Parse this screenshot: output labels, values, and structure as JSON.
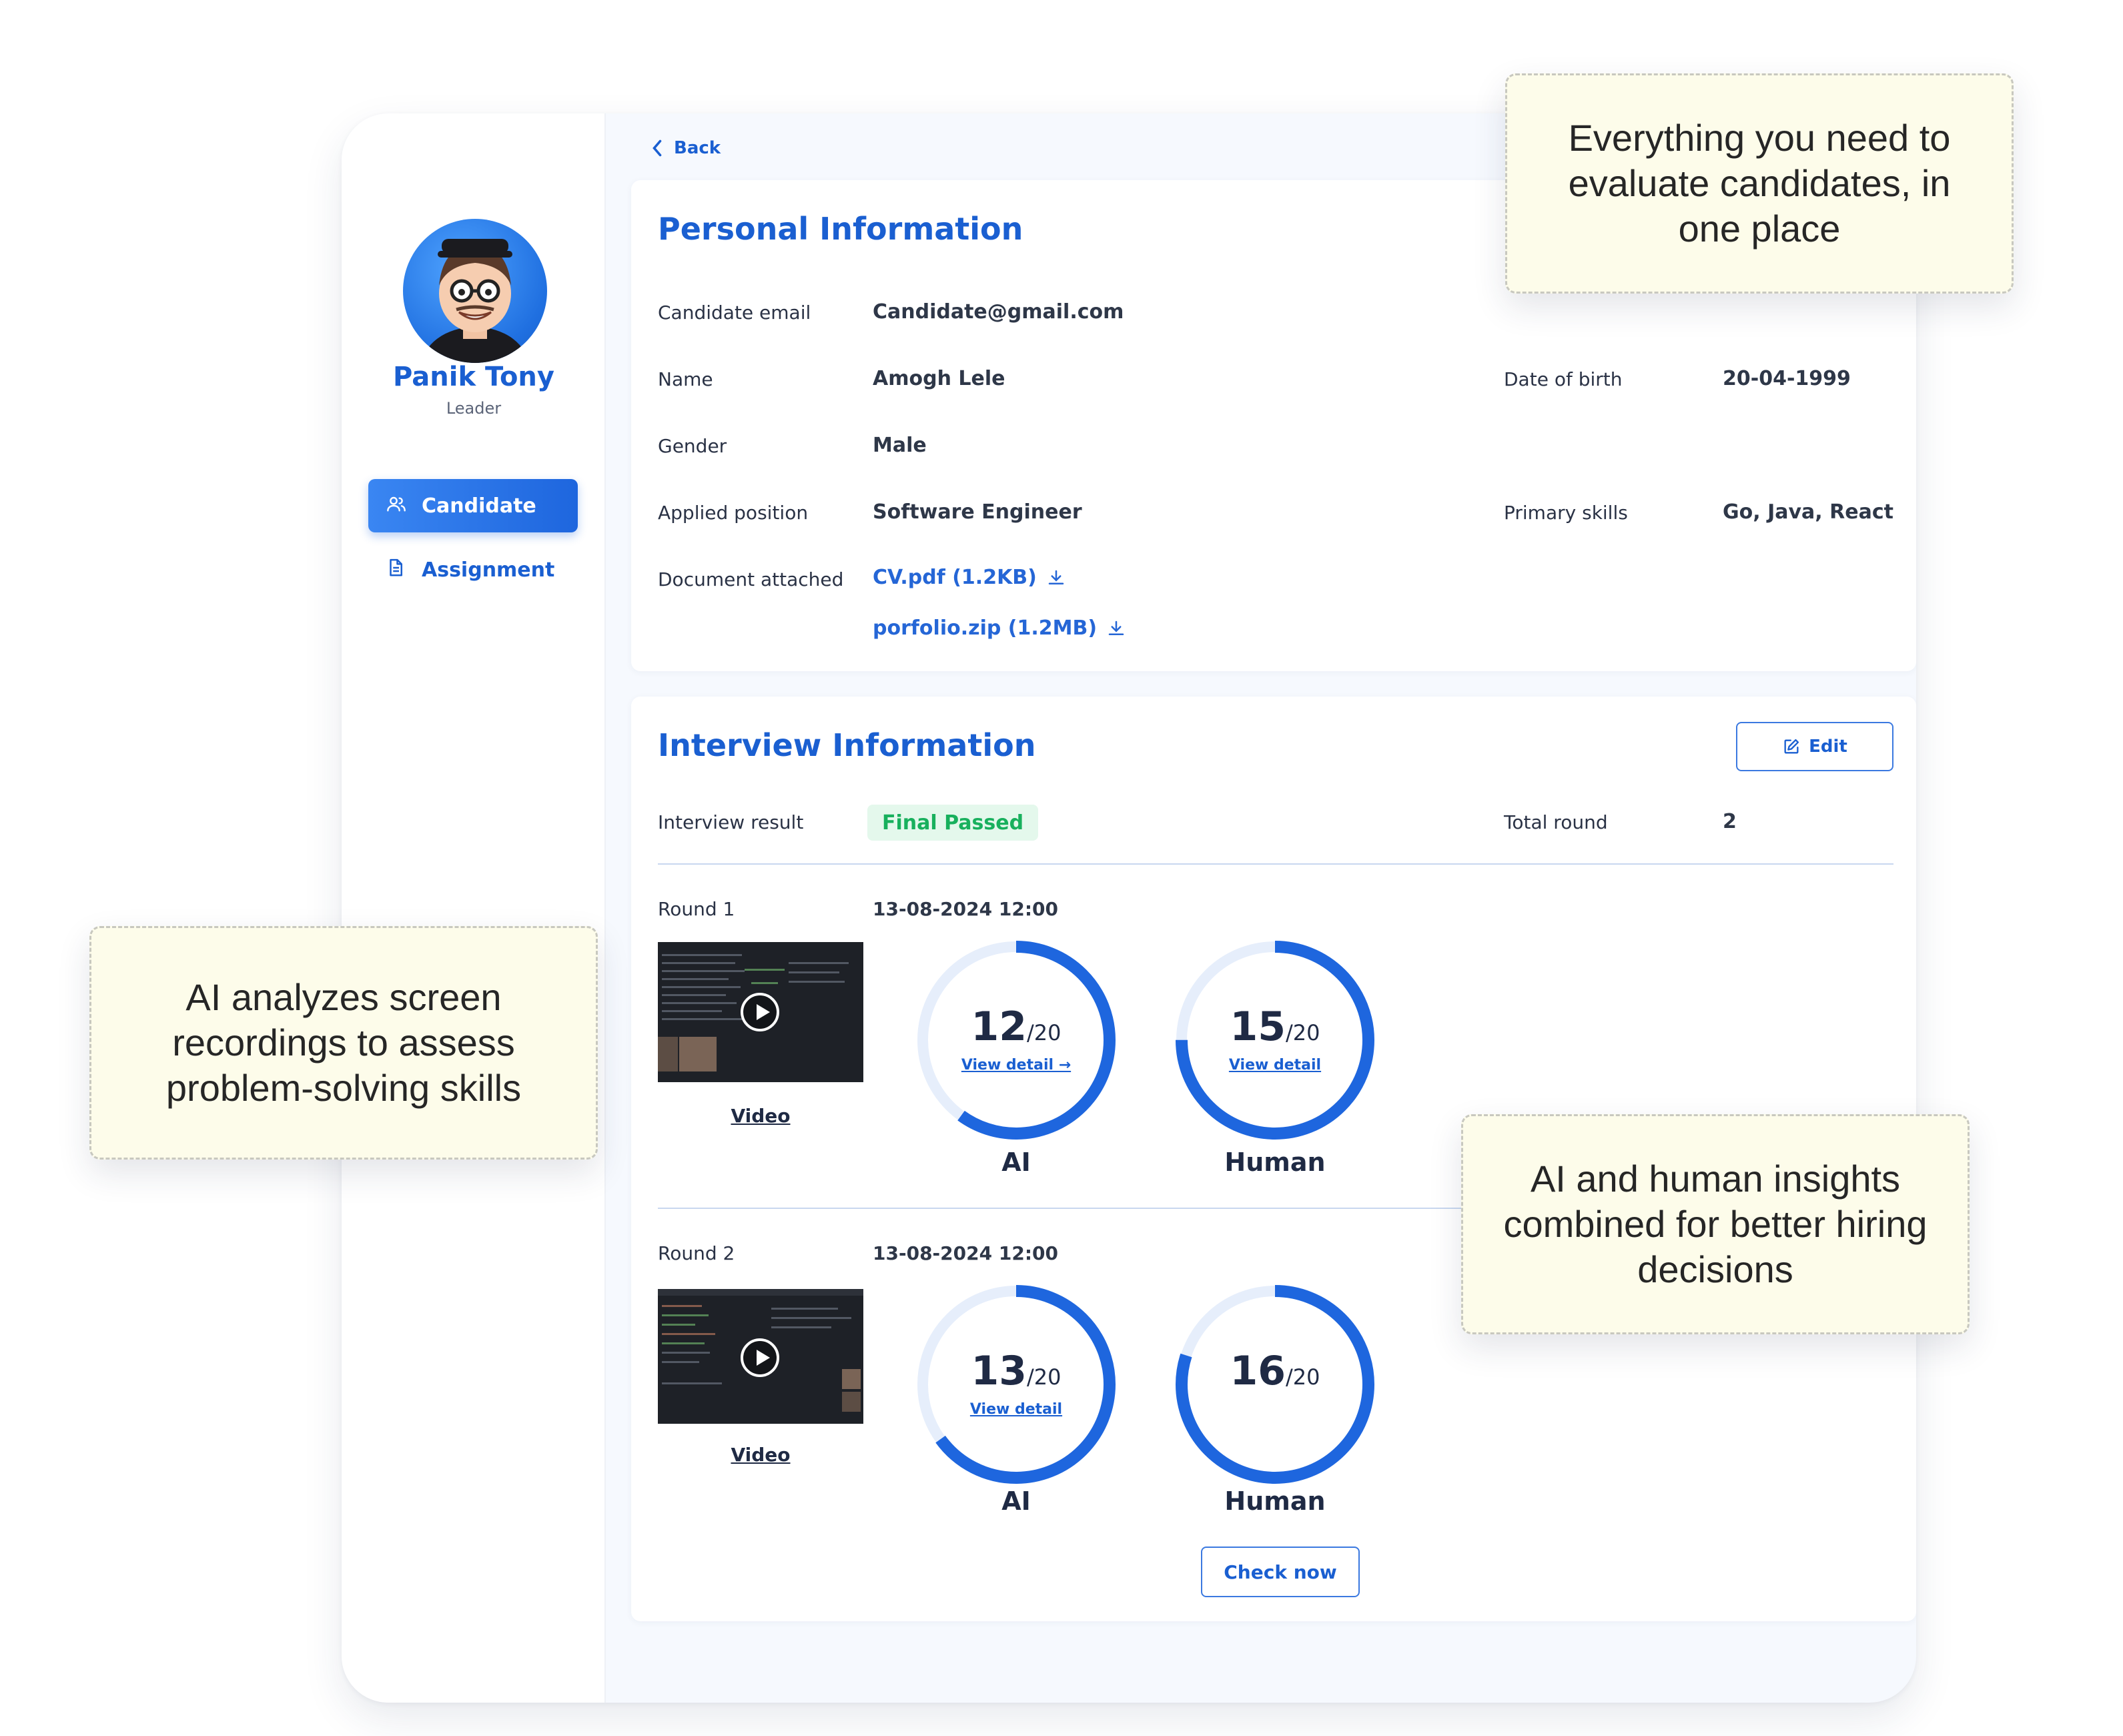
{
  "sidebar": {
    "user": {
      "name": "Panik Tony",
      "role": "Leader"
    },
    "nav": [
      {
        "label": "Candidate",
        "icon": "users-icon",
        "active": true
      },
      {
        "label": "Assignment",
        "icon": "document-icon",
        "active": false
      }
    ]
  },
  "back_label": "Back",
  "personal": {
    "title": "Personal Information",
    "email_label": "Candidate email",
    "email": "Candidate@gmail.com",
    "name_label": "Name",
    "name": "Amogh Lele",
    "dob_label": "Date of birth",
    "dob": "20-04-1999",
    "gender_label": "Gender",
    "gender": "Male",
    "position_label": "Applied position",
    "position": "Software Engineer",
    "skills_label": "Primary skills",
    "skills": "Go, Java, React",
    "docs_label": "Document attached",
    "docs": [
      "CV.pdf (1.2KB)",
      "porfolio.zip (1.2MB)"
    ]
  },
  "interview": {
    "title": "Interview Information",
    "edit_label": "Edit",
    "result_label": "Interview result",
    "result": "Final Passed",
    "total_round_label": "Total round",
    "total_round": "2",
    "rounds": [
      {
        "label": "Round 1",
        "datetime": "13-08-2024 12:00",
        "video_label": "Video",
        "ai": {
          "score": "12",
          "max": "/20",
          "detail": "View detail →",
          "label": "AI"
        },
        "human": {
          "score": "15",
          "max": "/20",
          "detail": "View detail",
          "label": "Human"
        }
      },
      {
        "label": "Round 2",
        "datetime": "13-08-2024 12:00",
        "video_label": "Video",
        "ai": {
          "score": "13",
          "max": "/20",
          "detail": "View detail",
          "label": "AI"
        },
        "human": {
          "score": "16",
          "max": "/20",
          "label": "Human"
        }
      }
    ],
    "check_now_label": "Check now"
  },
  "callouts": {
    "top_right": "Everything you need to evaluate candidates, in one place",
    "left": "AI analyzes screen recordings to assess problem-solving skills",
    "right": "AI and human insights combined for better hiring decisions"
  },
  "colors": {
    "accent": "#1a5fd1",
    "ring": "#1e66de",
    "ring_track": "#e6eefb",
    "success": "#18b05d",
    "note_bg": "#fdfcea"
  }
}
